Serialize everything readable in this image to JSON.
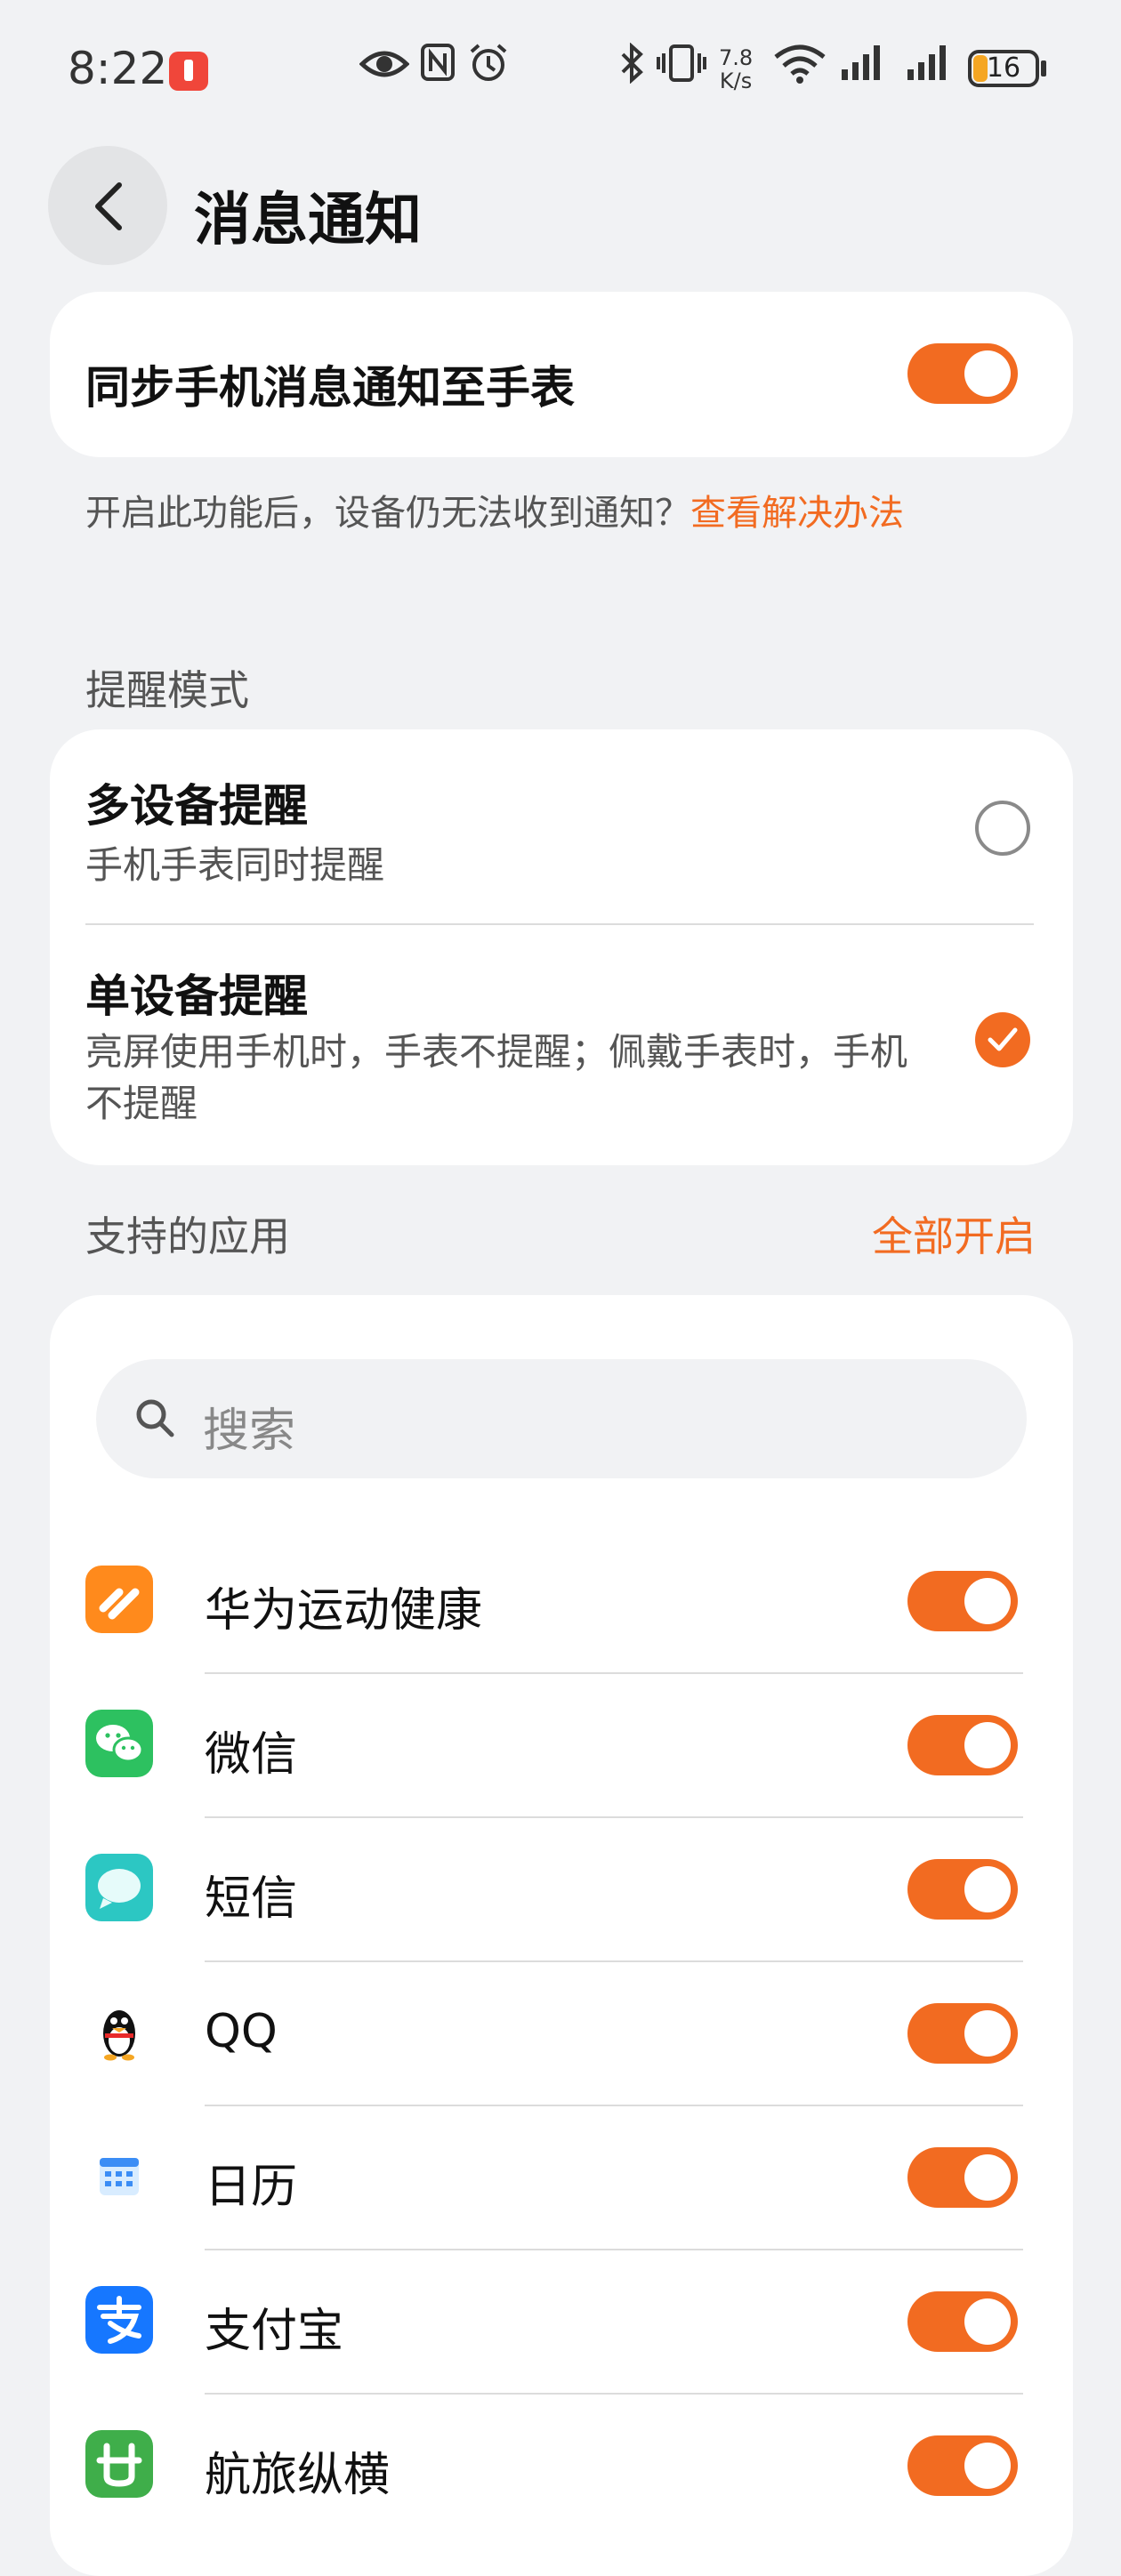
{
  "status_bar": {
    "time": "8:22",
    "net_speed_value": "7.8",
    "net_speed_unit": "K/s",
    "battery": "16",
    "icons": [
      "notification-badge-icon",
      "eye-icon",
      "nfc-icon",
      "alarm-icon",
      "bluetooth-icon",
      "vibrate-icon",
      "wifi-icon",
      "signal-icon",
      "signal-icon"
    ]
  },
  "header": {
    "title": "消息通知",
    "back_icon": "chevron-left-icon"
  },
  "sync": {
    "label": "同步手机消息通知至手表",
    "enabled": true,
    "hint": "开启此功能后，设备仍无法收到通知？",
    "hint_link": "查看解决办法"
  },
  "reminder_mode": {
    "section_label": "提醒模式",
    "options": [
      {
        "title": "多设备提醒",
        "desc": "手机手表同时提醒",
        "selected": false
      },
      {
        "title": "单设备提醒",
        "desc": "亮屏使用手机时，手表不提醒；佩戴手表时，手机不提醒",
        "selected": true
      }
    ]
  },
  "apps": {
    "section_label": "支持的应用",
    "enable_all": "全部开启",
    "search_placeholder": "搜索",
    "items": [
      {
        "name": "华为运动健康",
        "icon": "huawei-health-icon",
        "enabled": true
      },
      {
        "name": "微信",
        "icon": "wechat-icon",
        "enabled": true
      },
      {
        "name": "短信",
        "icon": "messages-icon",
        "enabled": true
      },
      {
        "name": "QQ",
        "icon": "qq-penguin-icon",
        "enabled": true
      },
      {
        "name": "日历",
        "icon": "calendar-icon",
        "enabled": true
      },
      {
        "name": "支付宝",
        "icon": "alipay-icon",
        "enabled": true
      },
      {
        "name": "航旅纵横",
        "icon": "hanglv-icon",
        "enabled": true
      }
    ]
  },
  "colors": {
    "accent": "#f26b21",
    "background": "#f1f2f4",
    "card": "#ffffff"
  }
}
